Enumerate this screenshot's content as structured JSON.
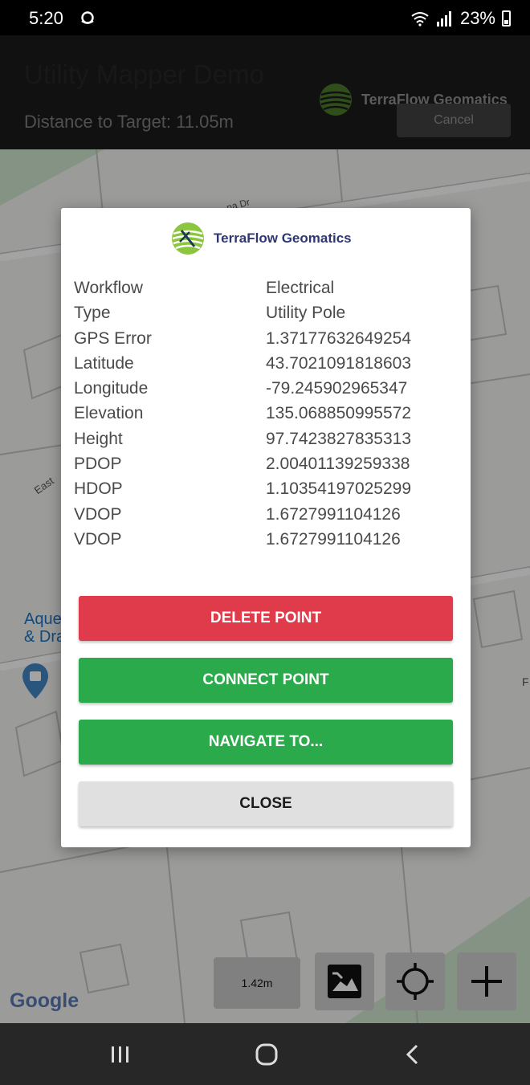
{
  "status_bar": {
    "time": "5:20",
    "battery": "23%"
  },
  "header": {
    "app_title": "Utility Mapper Demo",
    "brand_name": "TerraFlow Geomatics",
    "distance": "Distance to Target: 11.05m",
    "cancel_label": "Cancel"
  },
  "map": {
    "street_label": "na Dr",
    "east_label": "East",
    "poi_line1": "Aque",
    "poi_line2": "& Dra",
    "edge_label": "F",
    "google": "Google",
    "scale": "1.42m"
  },
  "dialog": {
    "brand_name": "TerraFlow Geomatics",
    "rows": [
      {
        "label": "Workflow",
        "value": "Electrical"
      },
      {
        "label": "Type",
        "value": "Utility Pole"
      },
      {
        "label": "GPS Error",
        "value": "1.37177632649254"
      },
      {
        "label": "Latitude",
        "value": "43.7021091818603"
      },
      {
        "label": "Longitude",
        "value": "-79.245902965347"
      },
      {
        "label": "Elevation",
        "value": "135.068850995572"
      },
      {
        "label": "Height",
        "value": "97.7423827835313"
      },
      {
        "label": "PDOP",
        "value": "2.00401139259338"
      },
      {
        "label": "HDOP",
        "value": "1.10354197025299"
      },
      {
        "label": "VDOP",
        "value": "1.6727991104126"
      },
      {
        "label": "VDOP",
        "value": "1.6727991104126"
      }
    ],
    "delete_label": "DELETE POINT",
    "connect_label": "CONNECT POINT",
    "navigate_label": "NAVIGATE TO...",
    "close_label": "CLOSE"
  },
  "colors": {
    "delete": "#e03b4a",
    "connect": "#2aaa4a",
    "brand_text": "#2e3774"
  },
  "icons": {
    "map_type": "map-layer-icon",
    "locate": "crosshair-icon",
    "add": "plus-icon"
  }
}
